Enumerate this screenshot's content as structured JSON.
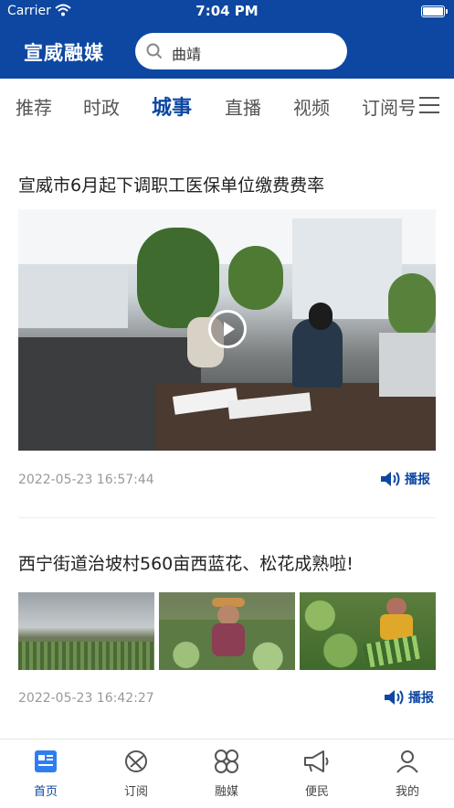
{
  "status_bar": {
    "carrier": "Carrier",
    "time": "7:04 PM"
  },
  "header": {
    "brand": "宣威融媒",
    "search_text": "曲靖"
  },
  "tabs": [
    "推荐",
    "时政",
    "城事",
    "直播",
    "视频",
    "订阅号"
  ],
  "active_tab": "城事",
  "articles": [
    {
      "title": "宣威市6月起下调职工医保单位缴费费率",
      "time": "2022-05-23 16:57:44",
      "tts_label": "播报",
      "media": "video"
    },
    {
      "title": "西宁街道治坡村560亩西蓝花、松花成熟啦!",
      "time": "2022-05-23 16:42:27",
      "tts_label": "播报",
      "media": "three-images"
    }
  ],
  "bottom_nav": [
    {
      "label": "首页",
      "icon": "home-news-icon",
      "active": true
    },
    {
      "label": "订阅",
      "icon": "subscribe-icon",
      "active": false
    },
    {
      "label": "融媒",
      "icon": "media-grid-icon",
      "active": false
    },
    {
      "label": "便民",
      "icon": "megaphone-icon",
      "active": false
    },
    {
      "label": "我的",
      "icon": "profile-icon",
      "active": false
    }
  ],
  "colors": {
    "brand_blue": "#0d47a1",
    "text": "#222222",
    "muted": "#999999"
  }
}
